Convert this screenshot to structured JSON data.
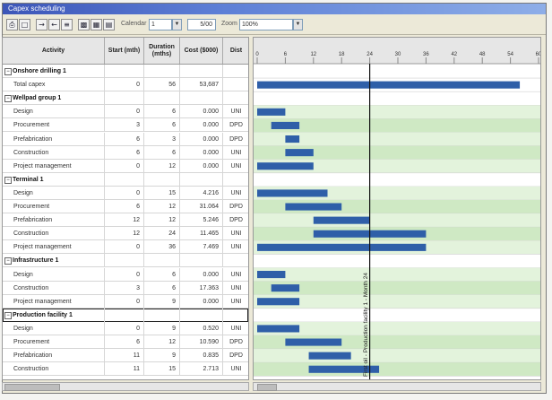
{
  "window": {
    "title": "Capex scheduling"
  },
  "toolbar": {
    "calendar_label": "Calendar",
    "calendar_value": "1",
    "period_value": "5/00",
    "zoom_label": "Zoom",
    "zoom_value": "100%"
  },
  "grid": {
    "columns": [
      "Activity",
      "Start (mth)",
      "Duration (mths)",
      "Cost ($000)",
      "Dist"
    ],
    "rows": [
      {
        "type": "group",
        "activity": "Onshore drilling 1",
        "start": "",
        "duration": "",
        "cost": "",
        "dist": ""
      },
      {
        "type": "task",
        "activity": "Total capex",
        "start": "0",
        "duration": "56",
        "cost": "53,687",
        "dist": ""
      },
      {
        "type": "group",
        "activity": "Wellpad group 1",
        "start": "",
        "duration": "",
        "cost": "",
        "dist": ""
      },
      {
        "type": "task",
        "activity": "Design",
        "start": "0",
        "duration": "6",
        "cost": "0.000",
        "dist": "UNI"
      },
      {
        "type": "task",
        "activity": "Procurement",
        "start": "3",
        "duration": "6",
        "cost": "0.000",
        "dist": "DPD"
      },
      {
        "type": "task",
        "activity": "Prefabrication",
        "start": "6",
        "duration": "3",
        "cost": "0.000",
        "dist": "DPD"
      },
      {
        "type": "task",
        "activity": "Construction",
        "start": "6",
        "duration": "6",
        "cost": "0.000",
        "dist": "UNI"
      },
      {
        "type": "task",
        "activity": "Project management",
        "start": "0",
        "duration": "12",
        "cost": "0.000",
        "dist": "UNI"
      },
      {
        "type": "group",
        "activity": "Terminal 1",
        "start": "",
        "duration": "",
        "cost": "",
        "dist": ""
      },
      {
        "type": "task",
        "activity": "Design",
        "start": "0",
        "duration": "15",
        "cost": "4.216",
        "dist": "UNI"
      },
      {
        "type": "task",
        "activity": "Procurement",
        "start": "6",
        "duration": "12",
        "cost": "31.064",
        "dist": "DPD"
      },
      {
        "type": "task",
        "activity": "Prefabrication",
        "start": "12",
        "duration": "12",
        "cost": "5.246",
        "dist": "DPD"
      },
      {
        "type": "task",
        "activity": "Construction",
        "start": "12",
        "duration": "24",
        "cost": "11.465",
        "dist": "UNI"
      },
      {
        "type": "task",
        "activity": "Project management",
        "start": "0",
        "duration": "36",
        "cost": "7.469",
        "dist": "UNI"
      },
      {
        "type": "group",
        "activity": "Infrastructure 1",
        "start": "",
        "duration": "",
        "cost": "",
        "dist": ""
      },
      {
        "type": "task",
        "activity": "Design",
        "start": "0",
        "duration": "6",
        "cost": "0.000",
        "dist": "UNI"
      },
      {
        "type": "task",
        "activity": "Construction",
        "start": "3",
        "duration": "6",
        "cost": "17.363",
        "dist": "UNI"
      },
      {
        "type": "task",
        "activity": "Project management",
        "start": "0",
        "duration": "9",
        "cost": "0.000",
        "dist": "UNI"
      },
      {
        "type": "group",
        "activity": "Production facility 1",
        "start": "",
        "duration": "",
        "cost": "",
        "dist": "",
        "highlight": true
      },
      {
        "type": "task",
        "activity": "Design",
        "start": "0",
        "duration": "9",
        "cost": "0.520",
        "dist": "UNI"
      },
      {
        "type": "task",
        "activity": "Procurement",
        "start": "6",
        "duration": "12",
        "cost": "10.590",
        "dist": "DPD"
      },
      {
        "type": "task",
        "activity": "Prefabrication",
        "start": "11",
        "duration": "9",
        "cost": "0.835",
        "dist": "DPD"
      },
      {
        "type": "task",
        "activity": "Construction",
        "start": "11",
        "duration": "15",
        "cost": "2.713",
        "dist": "UNI"
      }
    ]
  },
  "gantt": {
    "ticks": [
      0,
      6,
      12,
      18,
      24,
      30,
      36,
      42,
      48,
      54,
      60
    ],
    "axis_max": 60,
    "marker_month": 24,
    "marker_label": "First oil - Production facility 1 - Month 24",
    "bar_color": "#2f5fa8",
    "band_color": "#cfe9c4"
  }
}
